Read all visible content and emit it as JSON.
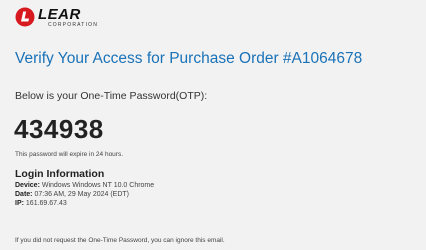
{
  "brand": {
    "logo_text": "LEAR",
    "logo_subtext": "CORPORATION",
    "brand_color": "#d71920"
  },
  "email": {
    "headline": "Verify Your Access for Purchase Order #A1064678",
    "intro": "Below is your One-Time Password(OTP):",
    "otp_code": "434938",
    "expiry_note": "This password will expire in 24 hours.",
    "login_info": {
      "title": "Login Information",
      "device_label": "Device:",
      "device_value": "Windows Windows NT 10.0 Chrome",
      "date_label": "Date:",
      "date_value": "07:36 AM, 29 May 2024 (EDT)",
      "ip_label": "IP:",
      "ip_value": "161.69.67.43"
    },
    "footer_note": "If you did not request the One-Time Password, you can ignore this email."
  },
  "colors": {
    "headline": "#1a72b8",
    "background": "#f2f2f2"
  }
}
